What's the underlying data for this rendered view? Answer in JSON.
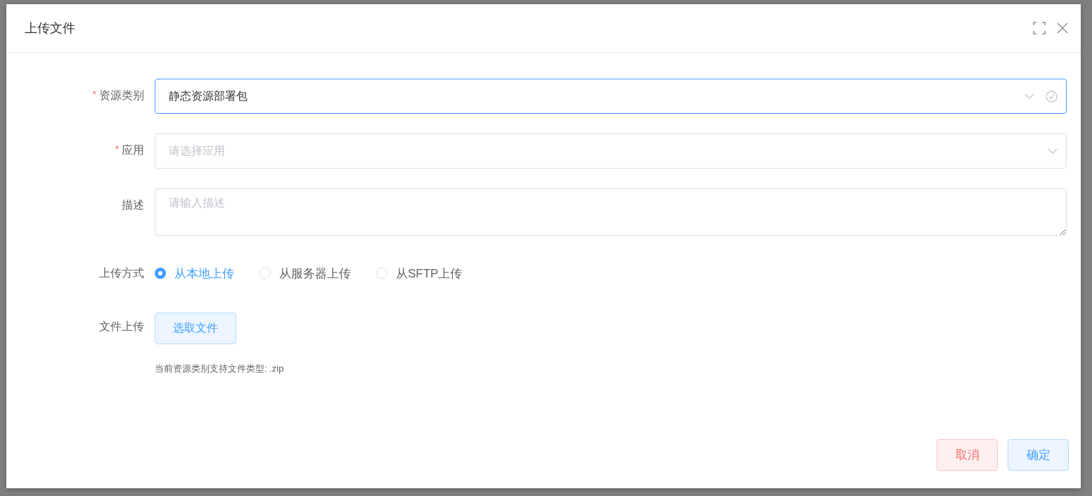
{
  "dialog": {
    "title": "上传文件"
  },
  "form": {
    "fields": [
      {
        "kind": "select",
        "label": "资源类别",
        "required_mark": "*",
        "focused": true,
        "value": "静态资源部署包"
      },
      {
        "kind": "select",
        "label": "应用",
        "required_mark": "*",
        "focused": false,
        "placeholder": "请选择应用"
      },
      {
        "kind": "textarea",
        "label": "描述",
        "placeholder": "请输入描述"
      },
      {
        "kind": "radio",
        "label": "上传方式",
        "options": [
          {
            "label": "从本地上传",
            "selected": true
          },
          {
            "label": "从服务器上传",
            "selected": false
          },
          {
            "label": "从SFTP上传",
            "selected": false
          }
        ]
      },
      {
        "kind": "upload",
        "label": "文件上传",
        "button": "选取文件",
        "hint": "当前资源类别支持文件类型: .zip"
      }
    ]
  },
  "footer_buttons": [
    {
      "label": "取消",
      "kind": "danger"
    },
    {
      "label": "确定",
      "kind": "primary"
    }
  ]
}
